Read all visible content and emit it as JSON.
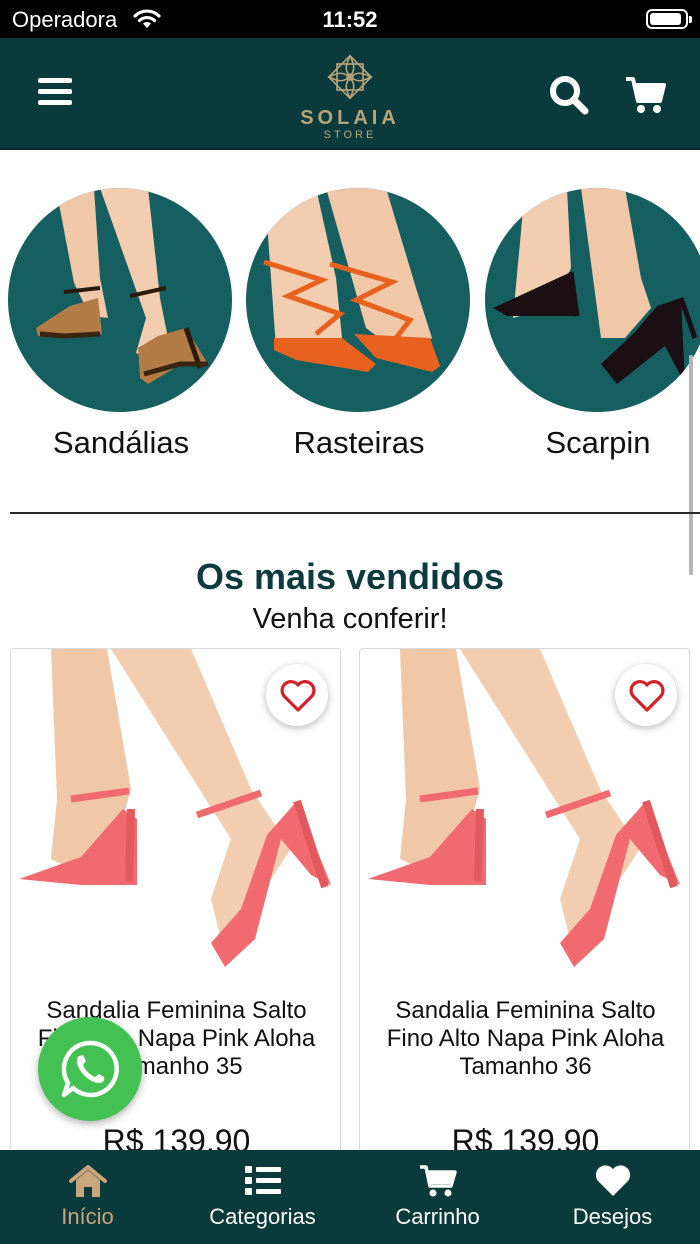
{
  "status_bar": {
    "carrier": "Operadora",
    "time": "11:52",
    "battery_level": 0.9
  },
  "header": {
    "menu_icon": "hamburger-icon",
    "logo": {
      "brand": "SOLAIA",
      "sub": "STORE"
    },
    "search_icon": "search-icon",
    "cart_icon": "cart-icon"
  },
  "categories": [
    {
      "label": "Sandálias"
    },
    {
      "label": "Rasteiras"
    },
    {
      "label": "Scarpin"
    }
  ],
  "best_sellers": {
    "title": "Os mais vendidos",
    "subtitle": "Venha conferir!",
    "products": [
      {
        "name": "Sandalia Feminina Salto Fino Alto Napa Pink Aloha Tamanho 35",
        "price": "R$ 139,90"
      },
      {
        "name": "Sandalia Feminina Salto Fino Alto Napa Pink Aloha Tamanho 36",
        "price": "R$ 139,90"
      }
    ]
  },
  "tabbar": {
    "tabs": [
      {
        "label": "Início",
        "icon": "home-icon",
        "active": true
      },
      {
        "label": "Categorias",
        "icon": "list-icon",
        "active": false
      },
      {
        "label": "Carrinho",
        "icon": "cart-icon",
        "active": false
      },
      {
        "label": "Desejos",
        "icon": "heart-icon",
        "active": false
      }
    ]
  },
  "colors": {
    "primary": "#0b3a3c",
    "accent": "#c9a57e",
    "category_bg": "#165f61",
    "whatsapp": "#44c153",
    "favorite": "#d81f26"
  }
}
